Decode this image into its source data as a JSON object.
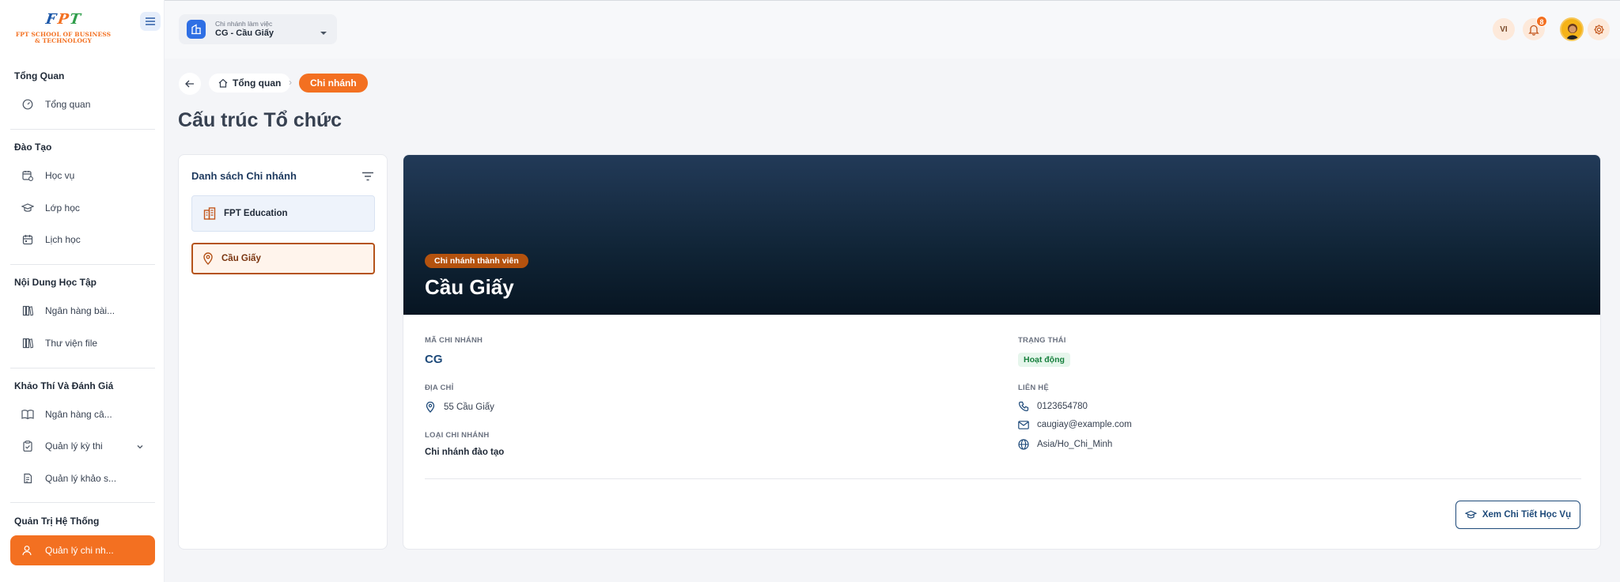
{
  "brand": {
    "logo_letters": [
      "F",
      "P",
      "T"
    ],
    "logo_colors": [
      "#1b57a8",
      "#f37021",
      "#2e9e4a"
    ],
    "logo_line1": "FPT SCHOOL OF BUSINESS",
    "logo_line2": "& TECHNOLOGY",
    "accent": "#f37021",
    "navy": "#1e4a7a"
  },
  "sidebar": {
    "sections": [
      {
        "title": "Tổng Quan",
        "items": [
          {
            "label": "Tổng quan",
            "icon": "dashboard-icon"
          }
        ]
      },
      {
        "title": "Đào Tạo",
        "items": [
          {
            "label": "Học vụ",
            "icon": "calendar-clock-icon"
          },
          {
            "label": "Lớp học",
            "icon": "graduation-cap-icon"
          },
          {
            "label": "Lịch học",
            "icon": "calendar-icon"
          }
        ]
      },
      {
        "title": "Nội Dung Học Tập",
        "items": [
          {
            "label": "Ngân hàng bài...",
            "icon": "library-icon"
          },
          {
            "label": "Thư viện file",
            "icon": "library-icon"
          }
        ]
      },
      {
        "title": "Khảo Thí Và Đánh Giá",
        "items": [
          {
            "label": "Ngân hàng câ...",
            "icon": "book-open-icon"
          },
          {
            "label": "Quản lý kỳ thi",
            "icon": "clipboard-check-icon"
          },
          {
            "label": "Quản lý khảo s...",
            "icon": "clipboard-list-icon"
          }
        ]
      },
      {
        "title": "Quản Trị Hệ Thống",
        "items": [
          {
            "label": "Quản lý chi nh...",
            "icon": "user-icon",
            "active": true
          }
        ]
      }
    ]
  },
  "header": {
    "branch_caption": "Chi nhánh làm việc",
    "branch_value": "CG - Cầu Giấy",
    "language": "VI",
    "notification_count": "8"
  },
  "breadcrumb": {
    "home": "Tổng quan",
    "separator": "›",
    "current": "Chi nhánh"
  },
  "page": {
    "title": "Cấu trúc Tổ chức"
  },
  "branch_list": {
    "title": "Danh sách Chi nhánh",
    "items": [
      {
        "label": "FPT Education",
        "icon": "building-icon"
      },
      {
        "label": "Cầu Giấy",
        "icon": "map-pin-icon",
        "selected": true
      }
    ]
  },
  "detail": {
    "badge": "Chi nhánh thành viên",
    "name": "Cầu Giấy",
    "code_label": "MÃ CHI NHÁNH",
    "code": "CG",
    "status_label": "TRẠNG THÁI",
    "status": "Hoạt động",
    "address_label": "ĐỊA CHỈ",
    "address": "55 Cầu Giấy",
    "contact_label": "LIÊN HỆ",
    "phone": "0123654780",
    "email": "caugiay@example.com",
    "timezone": "Asia/Ho_Chi_Minh",
    "type_label": "LOẠI CHI NHÁNH",
    "type": "Chi nhánh đào tạo",
    "detail_button": "Xem Chi Tiết Học Vụ"
  }
}
